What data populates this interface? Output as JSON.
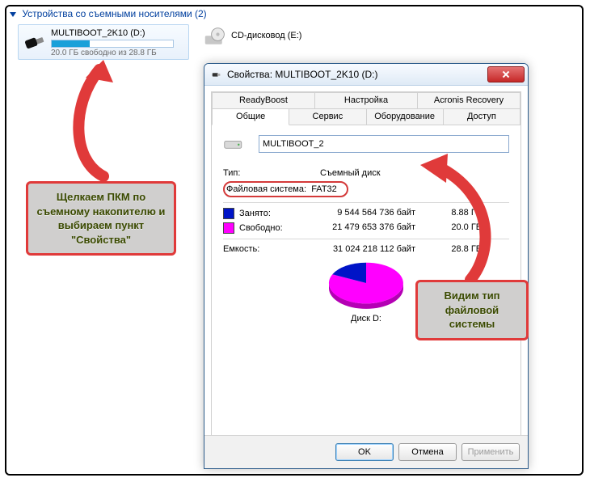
{
  "section_header": "Устройства со съемными носителями (2)",
  "usb": {
    "label": "MULTIBOOT_2K10 (D:)",
    "free_text": "20.0 ГБ свободно из 28.8 ГБ",
    "fill_percent": 31
  },
  "cd": {
    "label": "CD-дисковод (E:)"
  },
  "dialog": {
    "title": "Свойства: MULTIBOOT_2K10 (D:)",
    "tabs_row1": [
      "ReadyBoost",
      "Настройка",
      "Acronis Recovery"
    ],
    "tabs_row2": [
      "Общие",
      "Сервис",
      "Оборудование",
      "Доступ"
    ],
    "active_tab": "Общие",
    "name_field_selected": "MULTIBOOT_2",
    "rows": {
      "type_label": "Тип:",
      "type_value": "Съемный диск",
      "fs_label": "Файловая система:",
      "fs_value": "FAT32",
      "used_label": "Занято:",
      "used_bytes": "9 544 564 736 байт",
      "used_h": "8.88 ГБ",
      "free_label": "Свободно:",
      "free_bytes": "21 479 653 376 байт",
      "free_h": "20.0 ГБ",
      "cap_label": "Емкость:",
      "cap_bytes": "31 024 218 112 байт",
      "cap_h": "28.8 ГБ"
    },
    "disk_label": "Диск D:",
    "buttons": {
      "ok": "OK",
      "cancel": "Отмена",
      "apply": "Применить"
    }
  },
  "callouts": {
    "left": "Щелкаем ПКМ по съемному накопителю и выбираем пункт \"Свойства\"",
    "right": "Видим тип файловой системы"
  },
  "chart_data": {
    "type": "pie",
    "title": "Диск D:",
    "series": [
      {
        "name": "Занято",
        "value": 9544564736,
        "human": "8.88 ГБ",
        "color": "#0014c7"
      },
      {
        "name": "Свободно",
        "value": 21479653376,
        "human": "20.0 ГБ",
        "color": "#ff00ff"
      }
    ],
    "total": {
      "label": "Емкость",
      "value": 31024218112,
      "human": "28.8 ГБ"
    }
  }
}
